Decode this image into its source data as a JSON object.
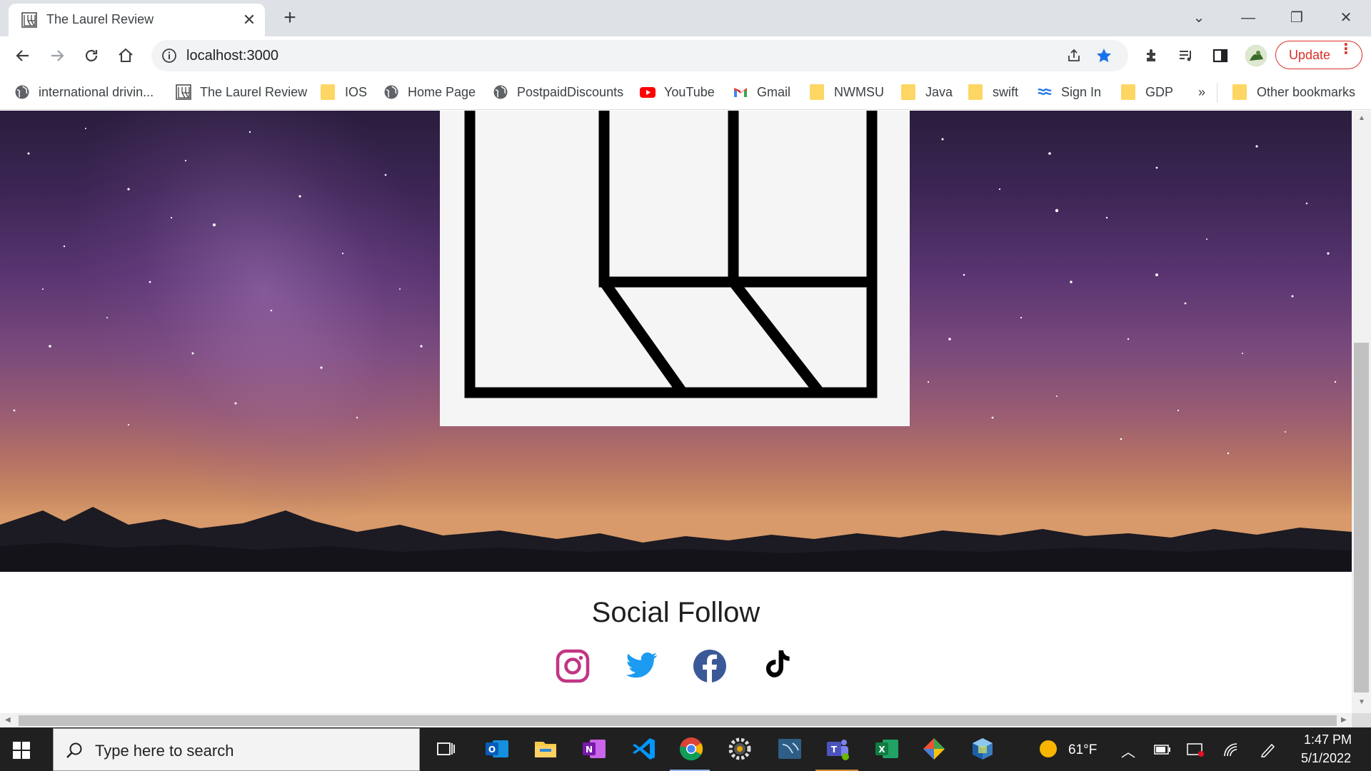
{
  "browser": {
    "tab": {
      "title": "The Laurel Review",
      "close_label": "✕"
    },
    "new_tab_label": "+",
    "window_controls": {
      "dropdown": "⌄",
      "minimize": "—",
      "restore": "❐",
      "close": "✕"
    },
    "address": {
      "url": "localhost:3000"
    },
    "update_button": {
      "label": "Update",
      "menu": "⋮"
    },
    "bookmarks": [
      {
        "label": "international drivin...",
        "icon": "globe-icon"
      },
      {
        "label": "The Laurel Review",
        "icon": "laurel-logo-icon"
      },
      {
        "label": "IOS",
        "icon": "folder-icon"
      },
      {
        "label": "Home Page",
        "icon": "globe-icon"
      },
      {
        "label": "PostpaidDiscounts",
        "icon": "globe-icon"
      },
      {
        "label": "YouTube",
        "icon": "youtube-icon"
      },
      {
        "label": "Gmail",
        "icon": "gmail-icon"
      },
      {
        "label": "NWMSU",
        "icon": "folder-icon"
      },
      {
        "label": "Java",
        "icon": "folder-icon"
      },
      {
        "label": "swift",
        "icon": "folder-icon"
      },
      {
        "label": "Sign In",
        "icon": "signin-icon"
      },
      {
        "label": "GDP",
        "icon": "folder-icon"
      }
    ],
    "bookmarks_overflow": "»",
    "other_bookmarks": "Other bookmarks"
  },
  "page": {
    "social_title": "Social Follow",
    "social_links": [
      {
        "name": "instagram-link",
        "icon": "instagram-icon",
        "color": "#c13584"
      },
      {
        "name": "twitter-link",
        "icon": "twitter-icon",
        "color": "#1d9bf0"
      },
      {
        "name": "facebook-link",
        "icon": "facebook-icon",
        "color": "#3b5998"
      },
      {
        "name": "tiktok-link",
        "icon": "tiktok-icon",
        "color": "#000000"
      }
    ]
  },
  "taskbar": {
    "search_placeholder": "Type here to search",
    "apps": [
      "task-view",
      "outlook",
      "file-explorer",
      "onenote",
      "vscode",
      "chrome",
      "settings-app",
      "mysql-workbench",
      "teams",
      "excel",
      "git-app",
      "virtualbox"
    ],
    "weather": "61°F",
    "time": "1:47 PM",
    "date": "5/1/2022"
  },
  "colors": {
    "accent_blue": "#1a73e8",
    "update_red": "#d93025"
  }
}
